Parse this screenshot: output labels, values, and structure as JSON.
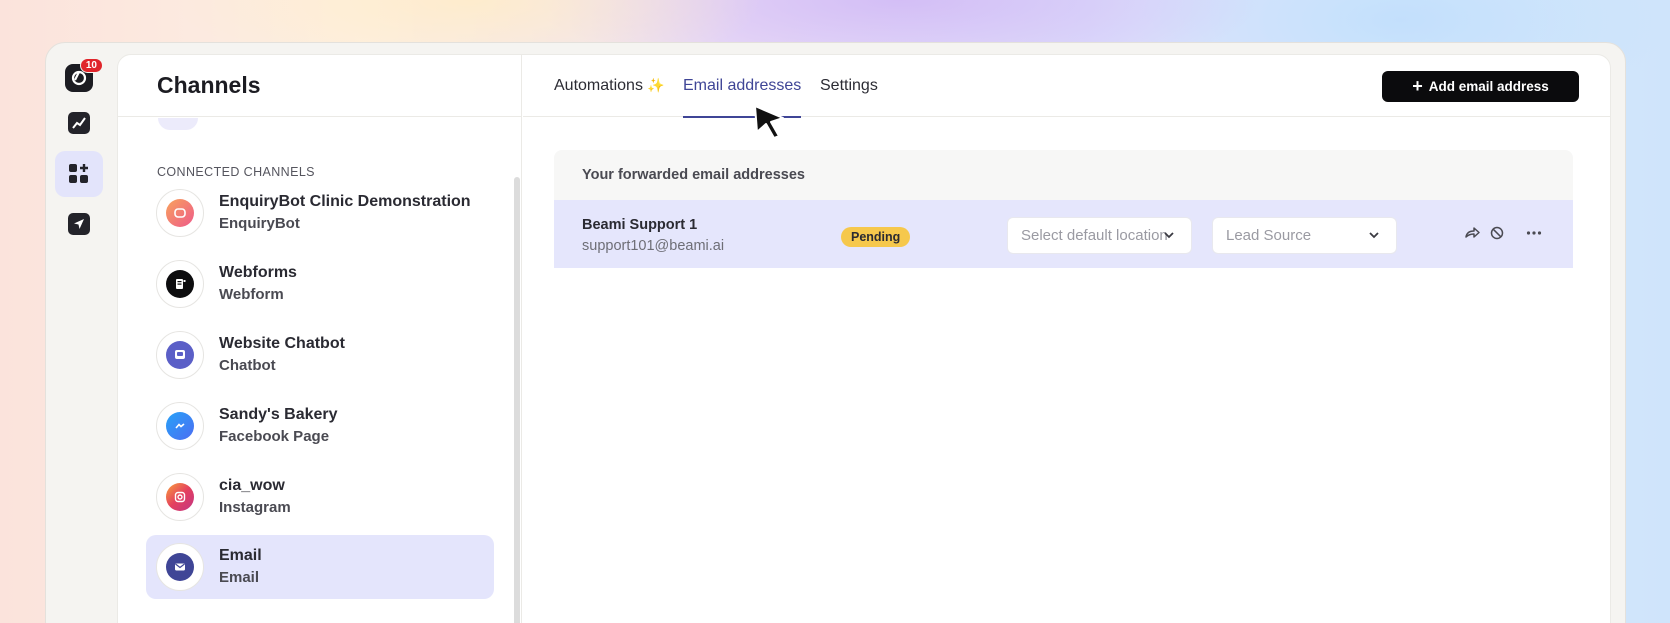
{
  "rail": {
    "notification_count": "10",
    "items": [
      {
        "icon": "brand-logo-icon"
      },
      {
        "icon": "chart-trend-icon"
      },
      {
        "icon": "apps-add-icon",
        "active": true
      },
      {
        "icon": "send-icon"
      }
    ]
  },
  "sidebar": {
    "title": "Channels",
    "section_label": "CONNECTED CHANNELS",
    "channels": [
      {
        "name": "EnquiryBot Clinic Demonstration",
        "type": "EnquiryBot",
        "icon": "enquirybot-icon",
        "color": "#f47a6a"
      },
      {
        "name": "Webforms",
        "type": "Webform",
        "icon": "webform-icon",
        "color": "#0d0d0f"
      },
      {
        "name": "Website Chatbot",
        "type": "Chatbot",
        "icon": "chatbot-icon",
        "color": "#5b5fc7"
      },
      {
        "name": "Sandy's Bakery",
        "type": "Facebook Page",
        "icon": "messenger-icon",
        "color": "#2e86f5"
      },
      {
        "name": "cia_wow",
        "type": "Instagram",
        "icon": "instagram-icon",
        "color": "#e4405f"
      },
      {
        "name": "Email",
        "type": "Email",
        "icon": "email-icon",
        "color": "#3f4596",
        "selected": true
      }
    ]
  },
  "tabs": [
    {
      "label": "Automations",
      "sparkle": "✨"
    },
    {
      "label": "Email addresses",
      "active": true
    },
    {
      "label": "Settings"
    }
  ],
  "add_button": {
    "label": "Add email address"
  },
  "panel": {
    "title": "Your forwarded email addresses",
    "rows": [
      {
        "name": "Beami Support 1",
        "email": "support101@beami.ai",
        "status": "Pending",
        "location_placeholder": "Select default location",
        "lead_source_placeholder": "Lead Source"
      }
    ]
  },
  "colors": {
    "accent": "#3f4596",
    "selected_bg": "#e4e5fc",
    "pending": "#f6c84c",
    "badge": "#e0242a"
  }
}
